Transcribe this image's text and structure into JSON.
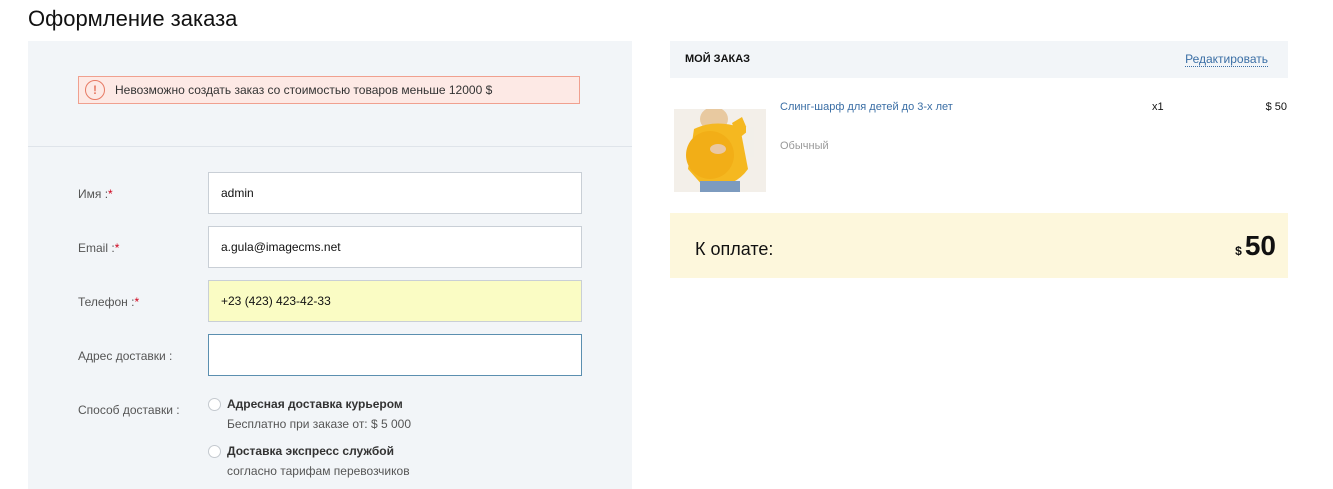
{
  "page": {
    "title": "Оформление заказа"
  },
  "alert": {
    "text": "Невозможно создать заказ со стоимостью товаров меньше 12000 $"
  },
  "form": {
    "name": {
      "label": "Имя :",
      "required": "*",
      "value": "admin"
    },
    "email": {
      "label": "Email :",
      "required": "*",
      "value": "a.gula@imagecms.net"
    },
    "phone": {
      "label": "Телефон :",
      "required": "*",
      "value": "+23 (423) 423-42-33"
    },
    "address": {
      "label": "Адрес доставки :",
      "value": ""
    },
    "delivery": {
      "label": "Способ доставки :",
      "options": [
        {
          "title": "Адресная доставка курьером",
          "sub": "Бесплатно при заказе от: $ 5 000"
        },
        {
          "title": "Доставка экспресс службой",
          "sub": "согласно тарифам перевозчиков"
        }
      ]
    }
  },
  "order": {
    "title": "МОЙ ЗАКАЗ",
    "edit_label": "Редактировать",
    "item": {
      "name": "Слинг-шарф для детей до 3-х лет",
      "variant": "Обычный",
      "qty": "x1",
      "price": "$ 50"
    },
    "total": {
      "label": "К оплате:",
      "currency": "$",
      "amount": "50"
    }
  },
  "colors": {
    "accent_link": "#3a6ea5",
    "alert_border": "#f0a08f",
    "total_bg": "#fdf7dc",
    "product_yellow": "#f5b820"
  }
}
